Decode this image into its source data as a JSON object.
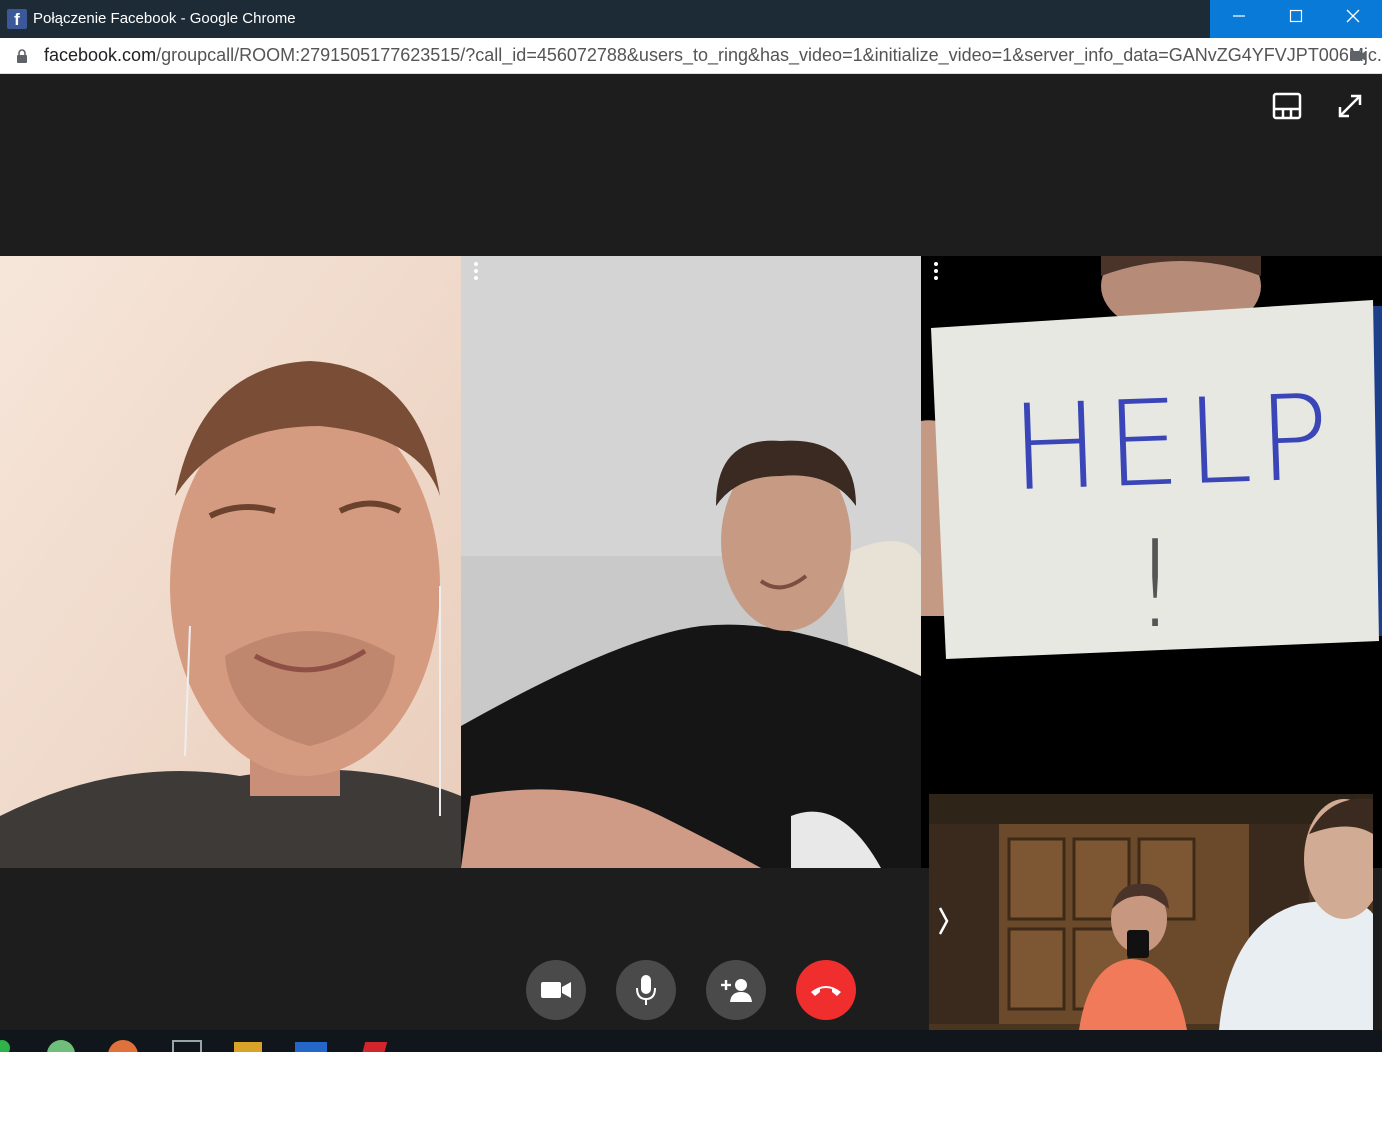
{
  "window": {
    "title": "Połączenie Facebook - Google Chrome",
    "favicon_icon": "facebook-icon",
    "controls": [
      "minimize-icon",
      "maximize-icon",
      "close-icon"
    ]
  },
  "address_bar": {
    "host": "facebook.com",
    "path": "/groupcall/ROOM:2791505177623515/?call_id=456072788&users_to_ring&has_video=1&initialize_video=1&server_info_data=GANvZG4YFVJPT006Mjc..."
  },
  "call": {
    "top_controls": [
      "layout-icon",
      "fullscreen-icon"
    ],
    "participants": [
      {
        "id": "participant-1"
      },
      {
        "id": "participant-2"
      },
      {
        "id": "participant-3",
        "sign_text": "HELP",
        "sign_mark": "!"
      }
    ],
    "self_view": {
      "collapse_icon": "chevron-left-icon"
    },
    "controls": [
      {
        "icon": "video-camera-icon"
      },
      {
        "icon": "microphone-icon"
      },
      {
        "icon": "add-person-icon"
      },
      {
        "icon": "end-call-icon",
        "color": "#f02e2e"
      }
    ]
  },
  "colors": {
    "background": "#1d1d1d",
    "titlebar": "#1c2b36",
    "accent": "#0a7ad8",
    "end_call": "#f02e2e",
    "control_button": "#4a4a4a"
  }
}
